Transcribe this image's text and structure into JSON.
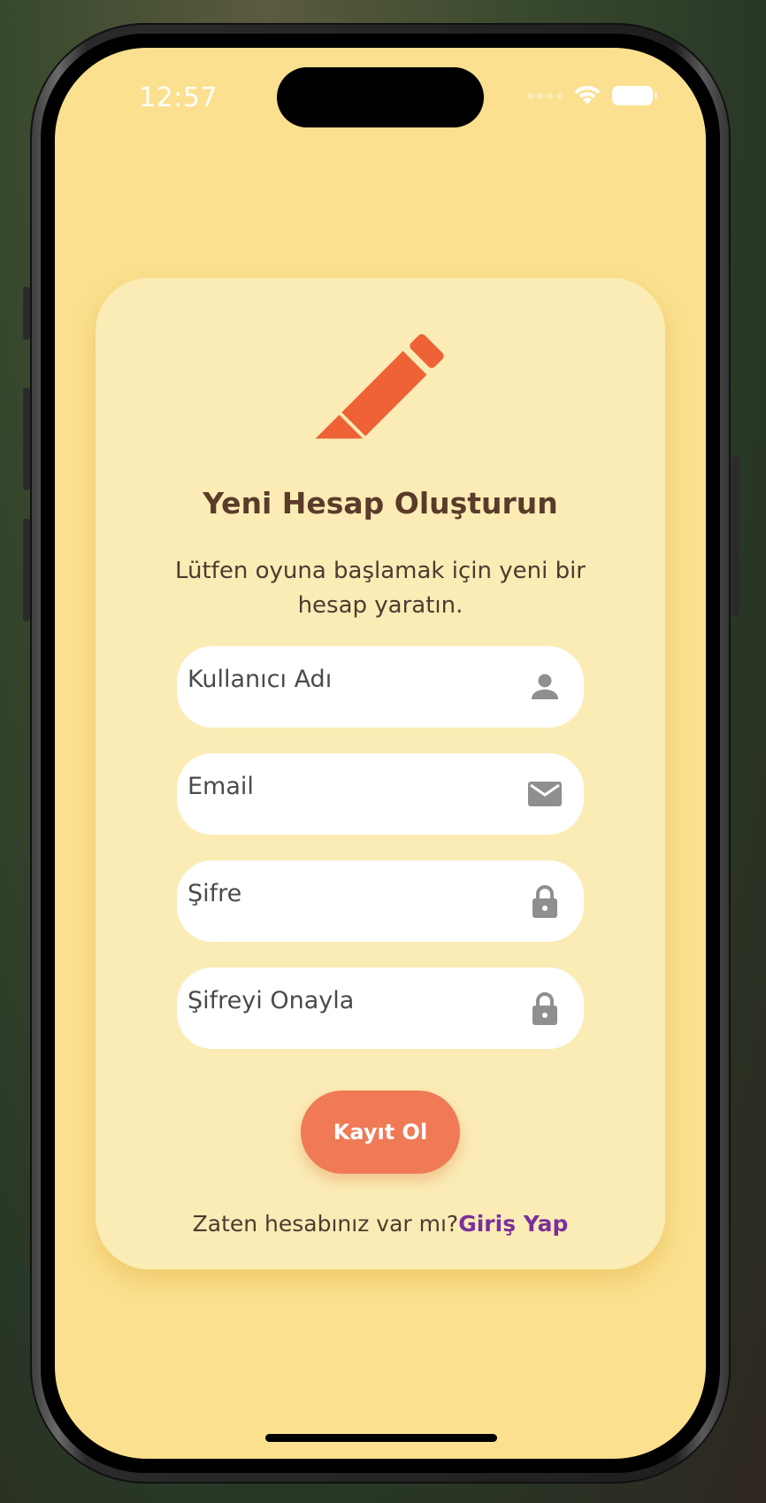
{
  "status_bar": {
    "time": "12:57"
  },
  "form": {
    "icon": "pencil-icon",
    "title": "Yeni Hesap Oluşturun",
    "subtitle": "Lütfen oyuna başlamak için yeni bir hesap yaratın.",
    "fields": [
      {
        "placeholder": "Kullanıcı Adı",
        "value": "",
        "icon": "person-icon"
      },
      {
        "placeholder": "Email",
        "value": "",
        "icon": "mail-icon"
      },
      {
        "placeholder": "Şifre",
        "value": "",
        "icon": "lock-icon"
      },
      {
        "placeholder": "Şifreyi Onayla",
        "value": "",
        "icon": "lock-icon"
      }
    ],
    "submit_label": "Kayıt Ol",
    "login_prompt": "Zaten hesabınız var mı?",
    "login_link": "Giriş Yap"
  },
  "colors": {
    "background": "#fbe08f",
    "card": "#fbecb6",
    "accent": "#ef7a55",
    "pencil": "#ee6236",
    "title_text": "#5a3b2a",
    "link": "#7b2f9c",
    "icon_gray": "#8f8f8f"
  }
}
